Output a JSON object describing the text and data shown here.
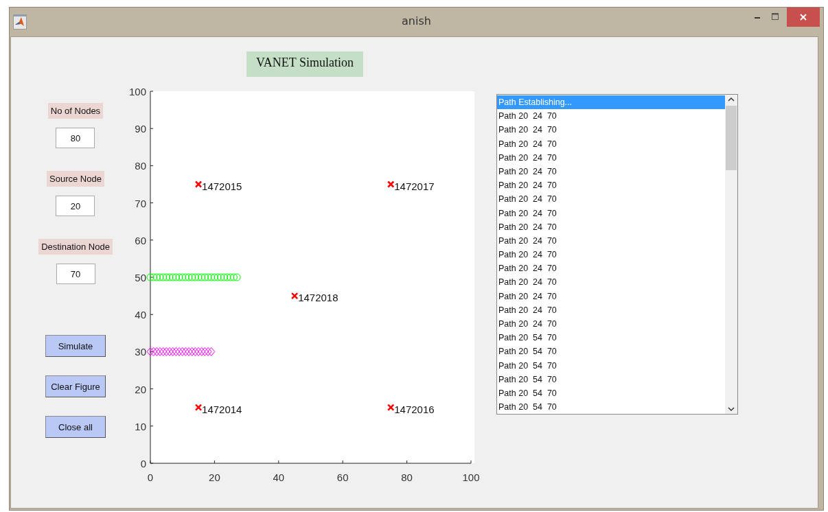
{
  "window": {
    "title": "anish"
  },
  "heading": "VANET Simulation",
  "fields": [
    {
      "label": "No of Nodes",
      "value": "80"
    },
    {
      "label": "Source Node",
      "value": "20"
    },
    {
      "label": "Destination Node",
      "value": "70"
    }
  ],
  "buttons": [
    "Simulate",
    "Clear Figure",
    "Close all"
  ],
  "chart_data": {
    "type": "scatter",
    "xlim": [
      0,
      100
    ],
    "ylim": [
      0,
      100
    ],
    "xticks": [
      0,
      20,
      40,
      60,
      80,
      100
    ],
    "yticks": [
      0,
      10,
      20,
      30,
      40,
      50,
      60,
      70,
      80,
      90,
      100
    ],
    "series": [
      {
        "color": "#ff0000",
        "marker": "x",
        "x": [
          15,
          75,
          45,
          15,
          75
        ],
        "values": [
          75,
          75,
          45,
          15,
          15
        ]
      },
      {
        "color": "#00ff00",
        "marker": "circle",
        "x": [
          0,
          1,
          2,
          3,
          4,
          5,
          6,
          7,
          8,
          9,
          10,
          11,
          12,
          13,
          14,
          15,
          16,
          17,
          18,
          19,
          20,
          21,
          22,
          23,
          24,
          25,
          26,
          27
        ],
        "values": [
          50,
          50,
          50,
          50,
          50,
          50,
          50,
          50,
          50,
          50,
          50,
          50,
          50,
          50,
          50,
          50,
          50,
          50,
          50,
          50,
          50,
          50,
          50,
          50,
          50,
          50,
          50,
          50
        ]
      },
      {
        "color": "#ff00ff",
        "marker": "diamond",
        "x": [
          0,
          1,
          2,
          3,
          4,
          5,
          6,
          7,
          8,
          9,
          10,
          11,
          12,
          13,
          14,
          15,
          16,
          17,
          18,
          19
        ],
        "values": [
          30,
          30,
          30,
          30,
          30,
          30,
          30,
          30,
          30,
          30,
          30,
          30,
          30,
          30,
          30,
          30,
          30,
          30,
          30,
          30
        ]
      }
    ],
    "annotations": [
      {
        "x": 15,
        "y": 75,
        "text": "1472015"
      },
      {
        "x": 75,
        "y": 75,
        "text": "1472017"
      },
      {
        "x": 45,
        "y": 45,
        "text": "1472018"
      },
      {
        "x": 15,
        "y": 15,
        "text": "1472014"
      },
      {
        "x": 75,
        "y": 15,
        "text": "1472016"
      }
    ]
  },
  "list": [
    {
      "text": "Path Establishing...",
      "selected": true
    },
    {
      "text": "Path 20  24  70",
      "selected": false
    },
    {
      "text": "Path 20  24  70",
      "selected": false
    },
    {
      "text": "Path 20  24  70",
      "selected": false
    },
    {
      "text": "Path 20  24  70",
      "selected": false
    },
    {
      "text": "Path 20  24  70",
      "selected": false
    },
    {
      "text": "Path 20  24  70",
      "selected": false
    },
    {
      "text": "Path 20  24  70",
      "selected": false
    },
    {
      "text": "Path 20  24  70",
      "selected": false
    },
    {
      "text": "Path 20  24  70",
      "selected": false
    },
    {
      "text": "Path 20  24  70",
      "selected": false
    },
    {
      "text": "Path 20  24  70",
      "selected": false
    },
    {
      "text": "Path 20  24  70",
      "selected": false
    },
    {
      "text": "Path 20  24  70",
      "selected": false
    },
    {
      "text": "Path 20  24  70",
      "selected": false
    },
    {
      "text": "Path 20  24  70",
      "selected": false
    },
    {
      "text": "Path 20  24  70",
      "selected": false
    },
    {
      "text": "Path 20  54  70",
      "selected": false
    },
    {
      "text": "Path 20  54  70",
      "selected": false
    },
    {
      "text": "Path 20  54  70",
      "selected": false
    },
    {
      "text": "Path 20  54  70",
      "selected": false
    },
    {
      "text": "Path 20  54  70",
      "selected": false
    },
    {
      "text": "Path 20  54  70",
      "selected": false
    }
  ]
}
